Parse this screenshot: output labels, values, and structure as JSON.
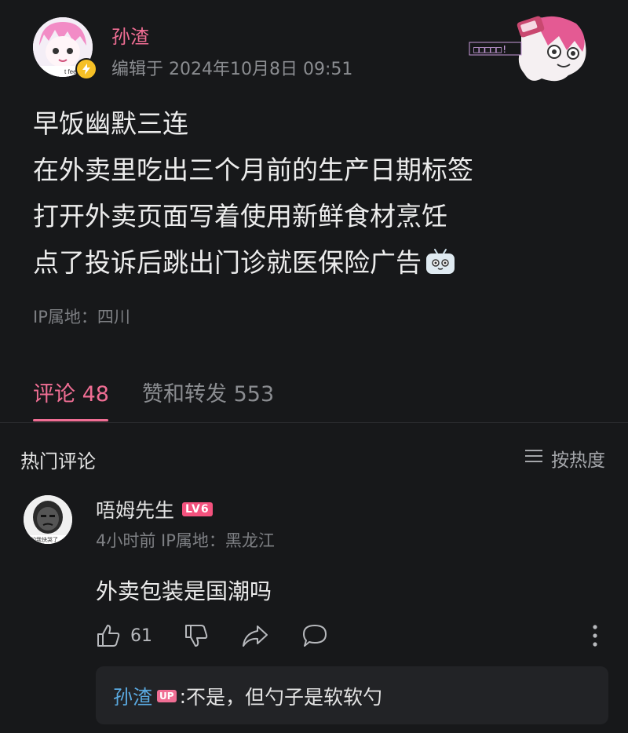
{
  "post": {
    "author": "孙渣",
    "meta": "编辑于 2024年10月8日 09:51",
    "avatar_caption": "t feel so",
    "sticker_text": "□□□□□!",
    "lines": [
      "早饭幽默三连",
      "在外卖里吃出三个月前的生产日期标签",
      "打开外卖页面写着使用新鲜食材烹饪",
      "点了投诉后跳出门诊就医保险广告"
    ],
    "ip": "IP属地：四川"
  },
  "tabs": {
    "comments": "评论 48",
    "likes_reposts": "赞和转发 553"
  },
  "comments_section": {
    "title": "热门评论",
    "sort_label": "按热度"
  },
  "comment": {
    "user": "唔姆先生",
    "level": "LV6",
    "avatar_caption": "的我快哭了",
    "meta": "4小时前  IP属地：黑龙江",
    "text": "外卖包装是国潮吗",
    "like_count": "61",
    "reply": {
      "user": "孙渣",
      "badge": "UP",
      "separator": ": ",
      "text": "不是，但勺子是软软勺"
    }
  },
  "colors": {
    "background": "#17181a",
    "accent_pink": "#f06e94",
    "reply_name_blue": "#5aa9e0",
    "muted_text": "#8b8d91"
  }
}
